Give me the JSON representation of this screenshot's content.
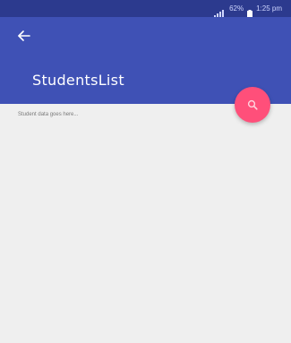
{
  "status_bar": {
    "battery_percent": "62%",
    "time": "1:25 pm"
  },
  "app_bar": {
    "title": "StudentsList"
  },
  "content": {
    "placeholder": "Student data goes here..."
  },
  "colors": {
    "status_bar": "#2c3a8e",
    "app_bar": "#3f51b5",
    "fab": "#ff4f7a",
    "background": "#efefef"
  },
  "icons": {
    "back": "arrow-back-icon",
    "fab": "search-icon",
    "signal": "signal-icon",
    "battery": "battery-icon"
  }
}
